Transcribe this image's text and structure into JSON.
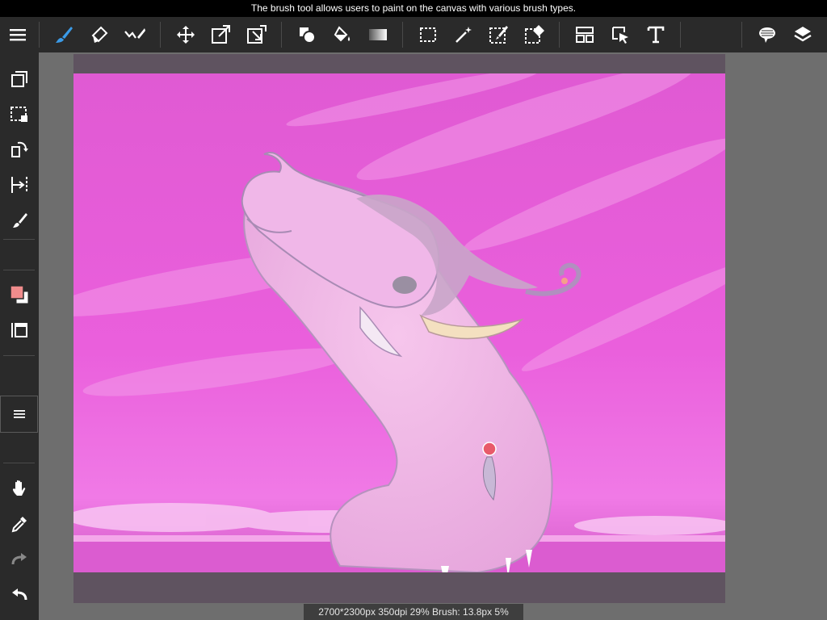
{
  "tooltip": "The brush tool allows users to paint on the canvas with various brush types.",
  "toolbar": {
    "active_tool": "brush",
    "tools": [
      "menu",
      "brush",
      "eraser",
      "smudge",
      "move",
      "transform",
      "transform-alt",
      "fill-shape",
      "bucket-fill",
      "gradient",
      "select-rect",
      "magic-wand",
      "select-pen",
      "select-eraser",
      "frame-divider",
      "select-layer",
      "text",
      "speech-balloon",
      "layers"
    ]
  },
  "leftbar": {
    "primary_color": "#f08c8c",
    "secondary_color": "#ffffff",
    "tools": [
      "copy-layer",
      "selection-transform",
      "rotate-canvas",
      "snap-ruler",
      "brush-size",
      "color",
      "layer-frame",
      "quick-menu",
      "hand",
      "eyedropper",
      "redo",
      "undo"
    ]
  },
  "canvas": {
    "sky_color": "#e85ed8",
    "info": "2700*2300px 350dpi 29% Brush: 13.8px 5%"
  }
}
